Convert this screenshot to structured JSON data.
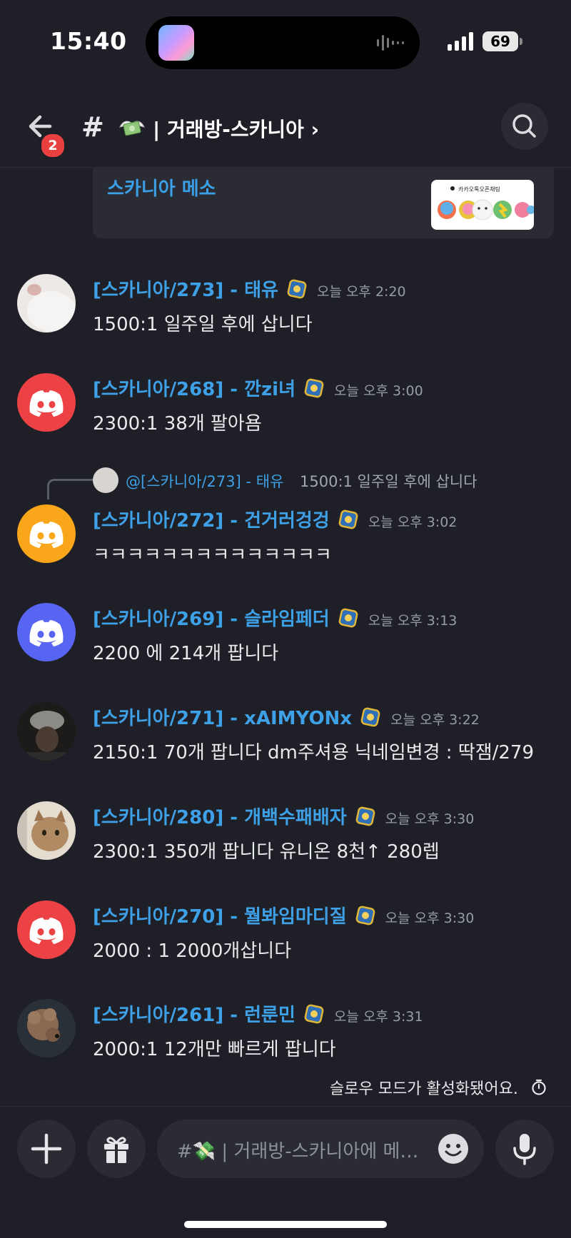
{
  "status": {
    "time": "15:40",
    "battery": "69"
  },
  "header": {
    "badge": "2",
    "hash": "#",
    "title": "| 거래방-스카니아 ›"
  },
  "embed": {
    "title": "스카니아 메소",
    "thumb_text": "카카오톡오픈채팅"
  },
  "messages": [
    {
      "name": "[스카니아/273] - 태유",
      "time": "오늘 오후 2:20",
      "text": "1500:1 일주일 후에 삽니다",
      "avatar_color": "#e9e6e3"
    },
    {
      "name": "[스카니아/268] - 깐zi녀",
      "time": "오늘 오후 3:00",
      "text": "2300:1 38개 팔아욤",
      "avatar_color": "#ed4245"
    },
    {
      "name": "[스카니아/272] - 건거러겅겅",
      "time": "오늘 오후 3:02",
      "text": "ㅋㅋㅋㅋㅋㅋㅋㅋㅋㅋㅋㅋㅋㅋ",
      "avatar_color": "#faa61a"
    },
    {
      "name": "[스카니아/269] - 슬라임페더",
      "time": "오늘 오후 3:13",
      "text": "2200 에 214개 팝니다",
      "avatar_color": "#5865f2"
    },
    {
      "name": "[스카니아/271] - xAIMYONx",
      "time": "오늘 오후 3:22",
      "text": "2150:1 70개 팝니다 dm주셔용 닉네임변경 : 딱잼/279",
      "avatar_color": "#2b2a28"
    },
    {
      "name": "[스카니아/280] - 개백수패배자",
      "time": "오늘 오후 3:30",
      "text": "2300:1  350개 팝니다 유니온 8천↑ 280렙",
      "avatar_color": "#b59a7e"
    },
    {
      "name": "[스카니아/270] - 뭘봐임마디질",
      "time": "오늘 오후 3:30",
      "text": "2000 : 1 2000개삽니다",
      "avatar_color": "#ed4245"
    },
    {
      "name": "[스카니아/261] - 런룬민",
      "time": "오늘 오후 3:31",
      "text": "2000:1 12개만 빠르게 팝니다",
      "avatar_color": "#6b5444"
    }
  ],
  "reply": {
    "name": "@[스카니아/273] - 태유",
    "text": "1500:1 일주일 후에 삽니다"
  },
  "slowmode": "슬로우 모드가 활성화됐어요.",
  "composer": {
    "placeholder": "#💸 | 거래방-스카니아에 메…"
  },
  "colors": {
    "background": "#1e1f27",
    "username": "#3ea0e6",
    "discord_red": "#ed4245",
    "discord_yellow": "#faa61a",
    "discord_blurple": "#5865f2"
  },
  "icons": [
    "back-arrow-icon",
    "search-icon",
    "plus-icon",
    "gift-icon",
    "emoji-icon",
    "microphone-icon",
    "timer-icon",
    "discord-logo-icon",
    "role-badge-icon"
  ]
}
